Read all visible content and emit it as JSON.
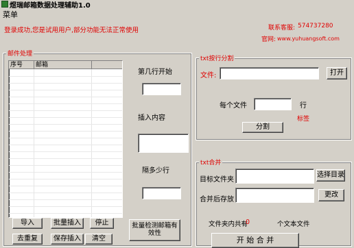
{
  "window": {
    "title": "煜瑞邮箱数据处理辅助1.0"
  },
  "menu": {
    "label": "菜单"
  },
  "status": {
    "login_message": "登录成功,您是试用用户,部分功能无法正常使用",
    "contact_label": "联系客服:",
    "contact_qq": "574737280",
    "website_label": "官网:",
    "website_url": "www.yuhuangsoft.com"
  },
  "mail_panel": {
    "title": "邮件处理",
    "columns": [
      "序号",
      "邮箱",
      ""
    ],
    "rows": [],
    "start_line_label": "第几行开始",
    "start_line_value": "",
    "insert_content_label": "插入内容",
    "insert_content_value": "",
    "interval_label": "隔多少行",
    "interval_value": "",
    "buttons": {
      "import": "导入",
      "batch_insert": "批量插入",
      "stop": "停止",
      "dedupe": "去重复",
      "save_insert": "保存插入",
      "clear": "清空",
      "batch_detect": "批量检测邮箱有效性"
    }
  },
  "split_panel": {
    "title": "txt按行分割",
    "file_label": "文件:",
    "file_value": "",
    "open_button": "打开",
    "each_file_label": "每个文件",
    "each_file_value": "",
    "lines_unit": "行",
    "tag_label": "标签",
    "split_button": "分割"
  },
  "merge_panel": {
    "title": "txt合并",
    "target_folder_label": "目标文件夹",
    "target_folder_value": "",
    "choose_folder_button": "选择目录",
    "save_after_merge_label": "合并后存放",
    "save_after_merge_value": "",
    "change_button": "更改",
    "folder_total_label": "文件夹内共有",
    "folder_total_count": "0",
    "text_files_label": "个文本文件",
    "start_merge_button": "开 始 合 并"
  }
}
